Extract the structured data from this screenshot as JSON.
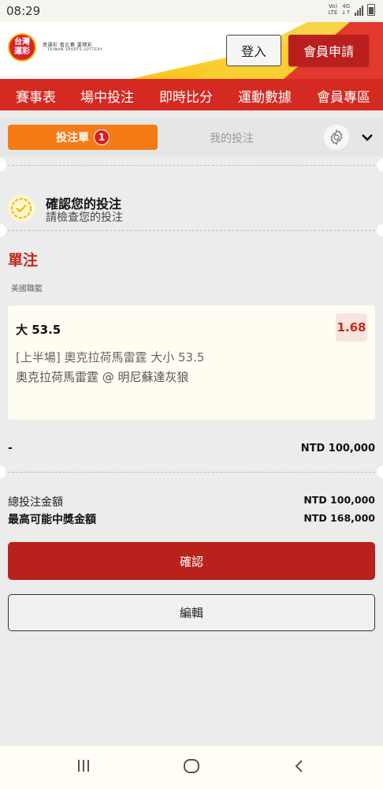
{
  "status_bar": {
    "time": "08:29",
    "net_top": "Vo)",
    "net_bottom": "LTE",
    "lte_top": "4G",
    "lte_bottom": "↓↑"
  },
  "header": {
    "logo_text": "台灣運彩",
    "logo_line1": "買運彩 看比賽 要精彩",
    "logo_line2": "TAIWAN SPORTS LOTTERY",
    "login_label": "登入",
    "signup_label": "會員申請"
  },
  "nav": {
    "items": [
      "賽事表",
      "場中投注",
      "即時比分",
      "運動數據",
      "會員專區"
    ]
  },
  "tabs": {
    "bet_slip_label": "投注單",
    "bet_count": "1",
    "my_bets_label": "我的投注"
  },
  "confirm": {
    "title": "確認您的投注",
    "subtitle": "請檢查您的投注"
  },
  "section": {
    "title": "單注",
    "league": "美國職籃"
  },
  "bet": {
    "selection": "大 53.5",
    "odds": "1.68",
    "market": "[上半場] 奧克拉荷馬雷霆 大小 53.5",
    "match": "奧克拉荷馬雷霆 @ 明尼蘇達灰狼"
  },
  "stake": {
    "label": "-",
    "value": "NTD 100,000"
  },
  "summary": {
    "total_label": "總投注金額",
    "total_value": "NTD 100,000",
    "max_win_label": "最高可能中獎金額",
    "max_win_value": "NTD 168,000"
  },
  "actions": {
    "confirm_label": "確認",
    "edit_label": "編輯"
  },
  "colors": {
    "brand_red": "#d42a22",
    "button_red": "#b9211d",
    "tab_orange": "#f47b16",
    "odds_red": "#c22a1f"
  },
  "icons": [
    "wifi-signal-icon",
    "battery-icon",
    "settings-gear-icon",
    "chevron-down-icon",
    "confirm-check-icon",
    "recent-apps-icon",
    "home-icon",
    "back-icon"
  ]
}
